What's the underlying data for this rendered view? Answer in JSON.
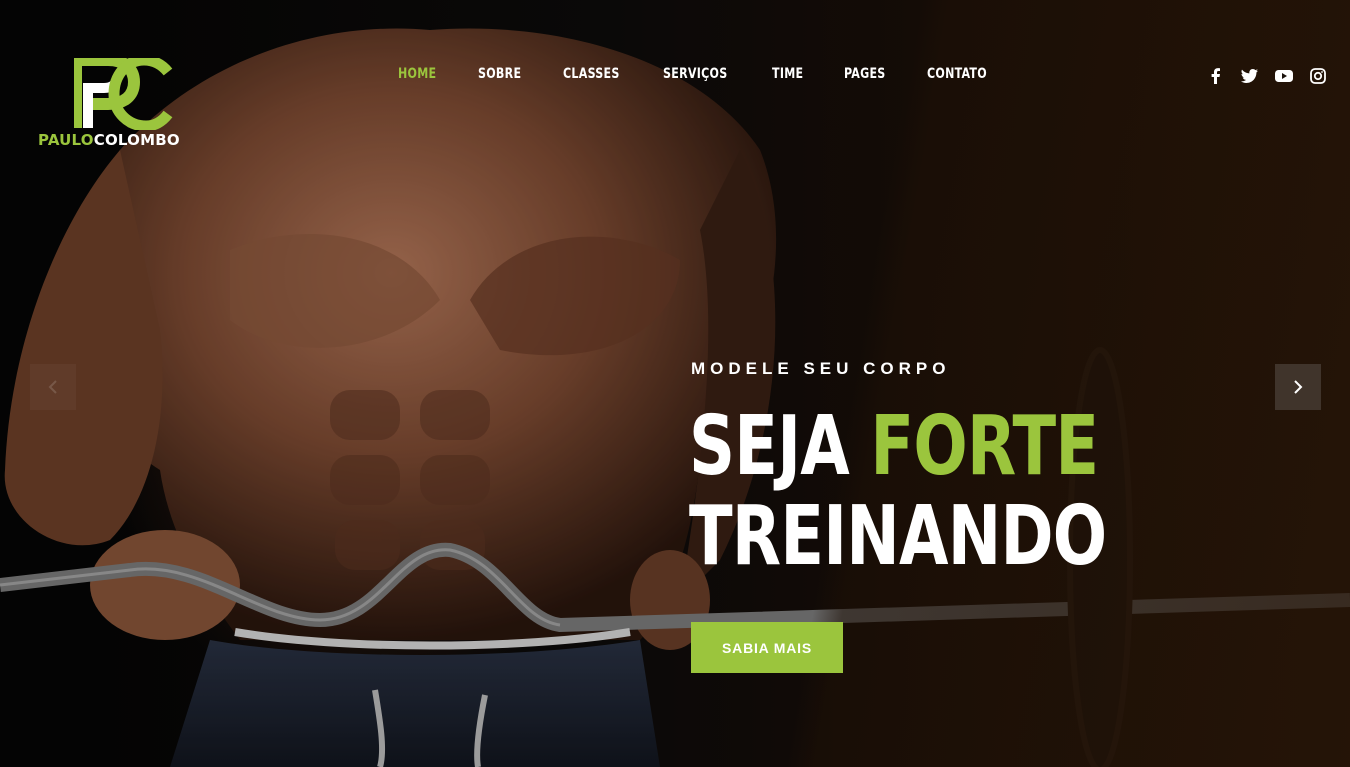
{
  "brand": {
    "logo_part1": "PAULO",
    "logo_part2": "COLOMBO",
    "accent_color": "#9bc53d"
  },
  "nav": {
    "items": [
      {
        "label": "HOME",
        "active": true
      },
      {
        "label": "SOBRE",
        "active": false
      },
      {
        "label": "CLASSES",
        "active": false
      },
      {
        "label": "SERVIÇOS",
        "active": false
      },
      {
        "label": "TIME",
        "active": false
      },
      {
        "label": "PAGES",
        "active": false
      },
      {
        "label": "CONTATO",
        "active": false
      }
    ]
  },
  "socials": [
    "facebook-icon",
    "twitter-icon",
    "youtube-icon",
    "instagram-icon"
  ],
  "hero": {
    "kicker": "MODELE SEU CORPO",
    "headline_word1": "SEJA",
    "headline_word2": "FORTE",
    "headline_line2": "TREINANDO",
    "cta_label": "SABIA MAIS"
  },
  "slider": {
    "prev_icon": "chevron-left-icon",
    "next_icon": "chevron-right-icon"
  }
}
